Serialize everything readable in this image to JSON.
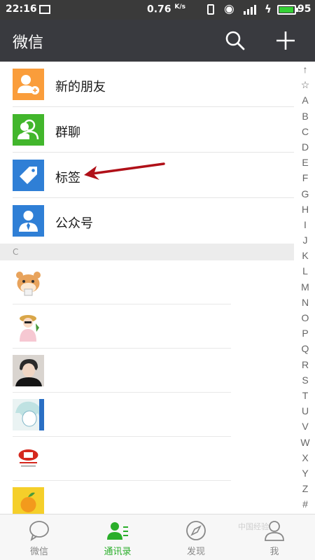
{
  "status_bar": {
    "time": "22:16",
    "speed": "0.76",
    "speed_unit": "K/s",
    "battery": "95",
    "battery_level": 0.95
  },
  "app_bar": {
    "title": "微信",
    "search_icon": "search-icon",
    "add_icon": "plus-icon"
  },
  "menu_items": [
    {
      "label": "新的朋友",
      "icon": "add-friend-icon",
      "color": "#fa9d3b"
    },
    {
      "label": "群聊",
      "icon": "group-chat-icon",
      "color": "#42b62c"
    },
    {
      "label": "标签",
      "icon": "tag-icon",
      "color": "#2f7fd6"
    },
    {
      "label": "公众号",
      "icon": "official-account-icon",
      "color": "#2f7fd6"
    }
  ],
  "section": {
    "letter": "C"
  },
  "contacts": [
    {
      "avatar": "hamster-avatar"
    },
    {
      "avatar": "girl-hat-avatar"
    },
    {
      "avatar": "boy-photo-avatar"
    },
    {
      "avatar": "anime-avatar"
    },
    {
      "avatar": "cz-logo-avatar"
    },
    {
      "avatar": "fruit-avatar"
    }
  ],
  "index_letters": [
    "↑",
    "☆",
    "A",
    "B",
    "C",
    "D",
    "E",
    "F",
    "G",
    "H",
    "I",
    "J",
    "K",
    "L",
    "M",
    "N",
    "O",
    "P",
    "Q",
    "R",
    "S",
    "T",
    "U",
    "V",
    "W",
    "X",
    "Y",
    "Z",
    "#"
  ],
  "tabs": [
    {
      "label": "微信",
      "icon": "chat-bubble-icon",
      "active": false
    },
    {
      "label": "通讯录",
      "icon": "contacts-icon",
      "active": true
    },
    {
      "label": "发现",
      "icon": "compass-icon",
      "active": false
    },
    {
      "label": "我",
      "icon": "person-icon",
      "active": false
    }
  ],
  "annotation": {
    "arrow_color": "#b01018"
  },
  "watermark": "中国经验"
}
